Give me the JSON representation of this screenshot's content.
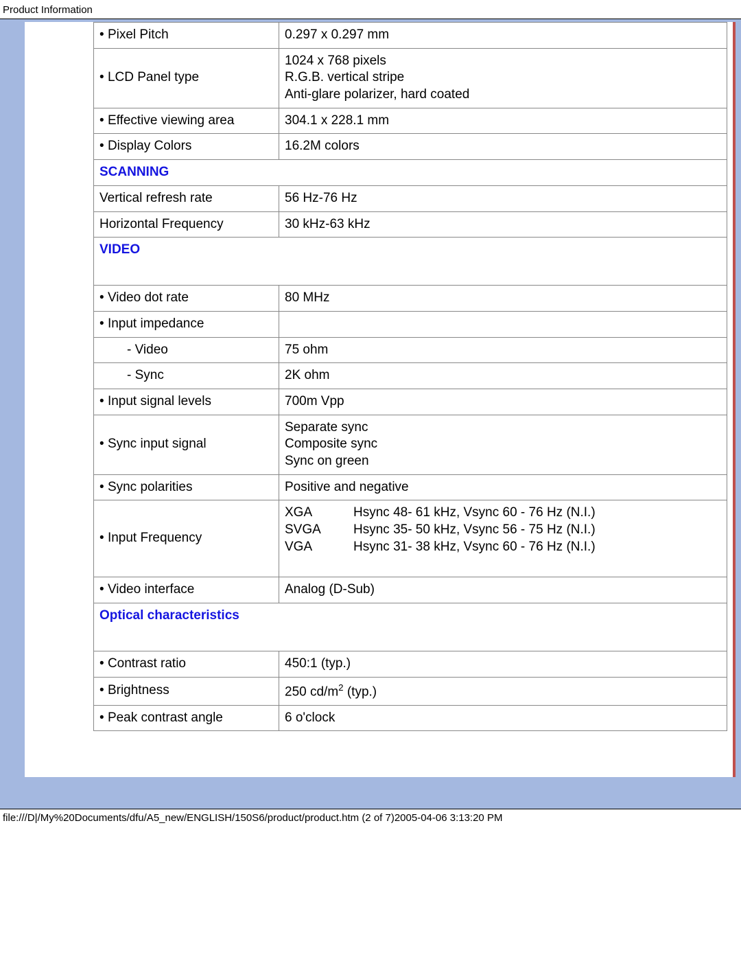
{
  "page_title": "Product Information",
  "footer": "file:///D|/My%20Documents/dfu/A5_new/ENGLISH/150S6/product/product.htm (2 of 7)2005-04-06 3:13:20 PM",
  "rows": {
    "pixel_pitch_label": "Pixel Pitch",
    "pixel_pitch_value": "0.297 x 0.297 mm",
    "lcd_panel_label": "LCD Panel type",
    "lcd_panel_l1": "1024 x 768 pixels",
    "lcd_panel_l2": "R.G.B. vertical stripe",
    "lcd_panel_l3": "Anti-glare polarizer, hard coated",
    "eff_view_label": "Effective viewing area",
    "eff_view_value": "304.1 x 228.1 mm",
    "disp_colors_label": "Display Colors",
    "disp_colors_value": "16.2M colors",
    "scanning_head": "SCANNING",
    "vert_refresh_label": "Vertical refresh rate",
    "vert_refresh_value": "56 Hz-76 Hz",
    "horiz_freq_label": "Horizontal Frequency",
    "horiz_freq_value": "30 kHz-63 kHz",
    "video_head": "VIDEO",
    "video_dot_label": "Video dot rate",
    "video_dot_value": "80 MHz",
    "input_imp_label": "Input impedance",
    "imp_video_label": "- Video",
    "imp_video_value": "75 ohm",
    "imp_sync_label": "- Sync",
    "imp_sync_value": "2K ohm",
    "input_sig_label": "Input signal levels",
    "input_sig_value": "700m Vpp",
    "sync_input_label": "Sync input signal",
    "sync_input_l1": "Separate sync",
    "sync_input_l2": "Composite sync",
    "sync_input_l3": "Sync on green",
    "sync_pol_label": "Sync polarities",
    "sync_pol_value": "Positive and negative",
    "input_freq_label": "Input Frequency",
    "freq_m1": "XGA",
    "freq_v1": "Hsync 48- 61 kHz, Vsync 60 - 76 Hz (N.I.)",
    "freq_m2": "SVGA",
    "freq_v2": "Hsync 35- 50 kHz, Vsync 56 - 75 Hz (N.I.)",
    "freq_m3": "VGA",
    "freq_v3": "Hsync 31- 38 kHz, Vsync 60 - 76 Hz (N.I.)",
    "video_if_label": "Video interface",
    "video_if_value": "Analog (D-Sub)",
    "optical_head": "Optical characteristics",
    "contrast_label": "Contrast ratio",
    "contrast_value": "450:1 (typ.)",
    "brightness_label": "Brightness",
    "brightness_pre": "250 cd/m",
    "brightness_sup": "2",
    "brightness_post": " (typ.)",
    "peak_contrast_label": "Peak contrast angle",
    "peak_contrast_value": "6 o'clock"
  }
}
